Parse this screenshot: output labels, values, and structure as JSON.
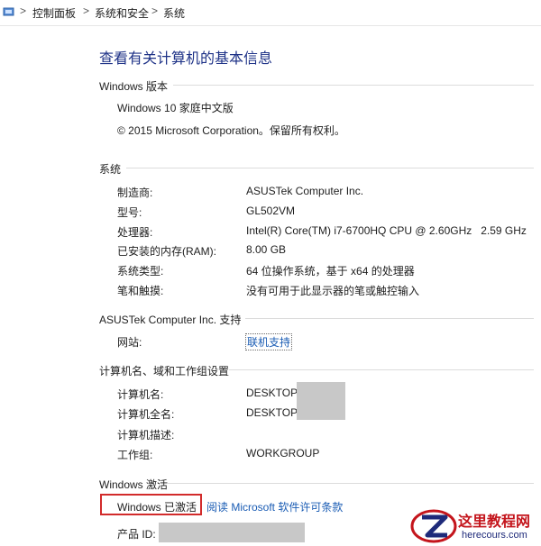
{
  "breadcrumb": {
    "items": [
      "控制面板",
      "系统和安全",
      "系统"
    ],
    "separator": ">"
  },
  "page_title": "查看有关计算机的基本信息",
  "windows_edition": {
    "heading": "Windows 版本",
    "edition": "Windows 10 家庭中文版",
    "copyright": "© 2015 Microsoft Corporation。保留所有权利。"
  },
  "system": {
    "heading": "系统",
    "rows": [
      {
        "label": "制造商:",
        "value": "ASUSTek Computer Inc."
      },
      {
        "label": "型号:",
        "value": "GL502VM"
      },
      {
        "label": "处理器:",
        "value": "Intel(R) Core(TM) i7-6700HQ CPU @ 2.60GHz   2.59 GHz"
      },
      {
        "label": "已安装的内存(RAM):",
        "value": "8.00 GB"
      },
      {
        "label": "系统类型:",
        "value": "64 位操作系统，基于 x64 的处理器"
      },
      {
        "label": "笔和触摸:",
        "value": "没有可用于此显示器的笔或触控输入"
      }
    ]
  },
  "support": {
    "heading": "ASUSTek Computer Inc. 支持",
    "website_label": "网站:",
    "website_link": "联机支持"
  },
  "computer_name": {
    "heading": "计算机名、域和工作组设置",
    "rows": [
      {
        "label": "计算机名:",
        "value": "DESKTOP-"
      },
      {
        "label": "计算机全名:",
        "value": "DESKTOP-"
      },
      {
        "label": "计算机描述:",
        "value": ""
      },
      {
        "label": "工作组:",
        "value": "WORKGROUP"
      }
    ]
  },
  "activation": {
    "heading": "Windows 激活",
    "status": "Windows 已激活",
    "license_link": "阅读 Microsoft 软件许可条款",
    "product_id_label": "产品 ID:"
  },
  "watermark": {
    "name": "这里教程网",
    "url": "herecours.com"
  },
  "colors": {
    "title": "#1e3287",
    "link": "#1a5cb4",
    "highlight_box": "#d22b2b",
    "watermark_red": "#c4151c"
  }
}
